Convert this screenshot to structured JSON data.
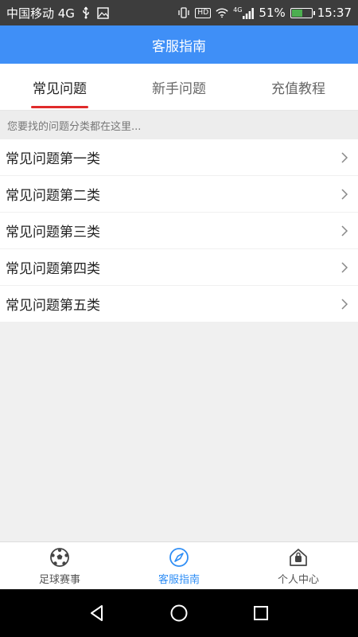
{
  "status_bar": {
    "carrier": "中国移动 4G",
    "network_badge": "4G",
    "hd_label": "HD",
    "battery_percent": "51%",
    "battery_level": 0.51,
    "time": "15:37"
  },
  "header": {
    "title": "客服指南"
  },
  "tabs": [
    {
      "label": "常见问题",
      "active": true
    },
    {
      "label": "新手问题",
      "active": false
    },
    {
      "label": "充值教程",
      "active": false
    }
  ],
  "hint": "您要找的问题分类都在这里...",
  "categories": [
    {
      "label": "常见问题第一类"
    },
    {
      "label": "常见问题第二类"
    },
    {
      "label": "常见问题第三类"
    },
    {
      "label": "常见问题第四类"
    },
    {
      "label": "常见问题第五类"
    }
  ],
  "bottom_nav": [
    {
      "label": "足球赛事",
      "icon": "soccer-ball-icon",
      "active": false
    },
    {
      "label": "客服指南",
      "icon": "compass-icon",
      "active": true
    },
    {
      "label": "个人中心",
      "icon": "house-bag-icon",
      "active": false
    }
  ],
  "colors": {
    "header": "#3f8ff7",
    "tab_indicator": "#e02b2b",
    "nav_active": "#2f8ef5",
    "battery": "#4caf50"
  }
}
